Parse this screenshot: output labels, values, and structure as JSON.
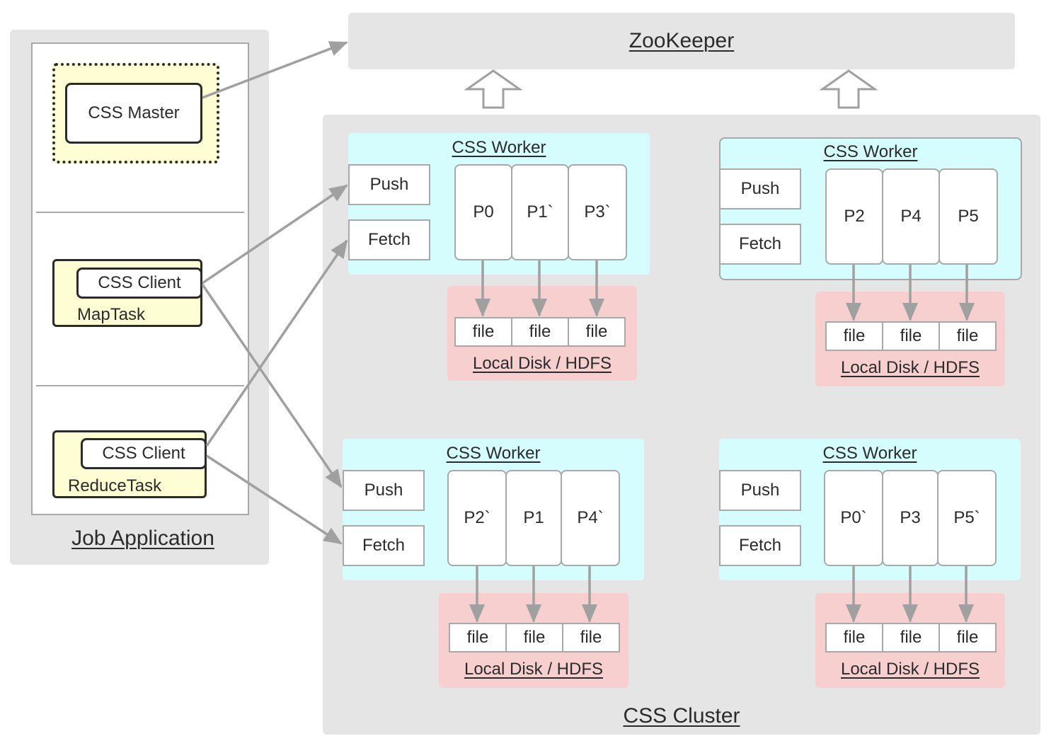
{
  "colors": {
    "panel_bg": "#e5e5e5",
    "task_bg": "#fefdd3",
    "worker_bg": "#d5fdfd",
    "disk_bg": "#f7cfcf",
    "arrow": "#a0a0a0",
    "text": "#2b2b2b"
  },
  "zookeeper": {
    "label": "ZooKeeper"
  },
  "job_application": {
    "label": "Job Application",
    "master": {
      "label": "CSS Master"
    },
    "map_task": {
      "label": "MapTask",
      "client_label": "CSS Client"
    },
    "reduce_task": {
      "label": "ReduceTask",
      "client_label": "CSS Client"
    }
  },
  "cluster": {
    "label": "CSS Cluster",
    "workers": [
      {
        "title": "CSS Worker",
        "push_label": "Push",
        "fetch_label": "Fetch",
        "partitions": [
          "P0",
          "P1`",
          "P3`"
        ],
        "files": [
          "file",
          "file",
          "file"
        ],
        "disk_label": "Local Disk / HDFS"
      },
      {
        "title": "CSS Worker",
        "push_label": "Push",
        "fetch_label": "Fetch",
        "partitions": [
          "P2",
          "P4",
          "P5"
        ],
        "files": [
          "file",
          "file",
          "file"
        ],
        "disk_label": "Local Disk / HDFS"
      },
      {
        "title": "CSS Worker",
        "push_label": "Push",
        "fetch_label": "Fetch",
        "partitions": [
          "P2`",
          "P1",
          "P4`"
        ],
        "files": [
          "file",
          "file",
          "file"
        ],
        "disk_label": "Local Disk / HDFS"
      },
      {
        "title": "CSS Worker",
        "push_label": "Push",
        "fetch_label": "Fetch",
        "partitions": [
          "P0`",
          "P3",
          "P5`"
        ],
        "files": [
          "file",
          "file",
          "file"
        ],
        "disk_label": "Local Disk / HDFS"
      }
    ]
  },
  "connections": [
    {
      "from": "CSS Master",
      "to": "ZooKeeper"
    },
    {
      "from": "MapTask CSS Client",
      "to": "Worker 1 Push"
    },
    {
      "from": "MapTask CSS Client",
      "to": "Worker 3 Push"
    },
    {
      "from": "ReduceTask CSS Client",
      "to": "Worker 1 Fetch"
    },
    {
      "from": "ReduceTask CSS Client",
      "to": "Worker 3 Fetch"
    },
    {
      "from": "CSS Cluster",
      "to": "ZooKeeper"
    }
  ]
}
